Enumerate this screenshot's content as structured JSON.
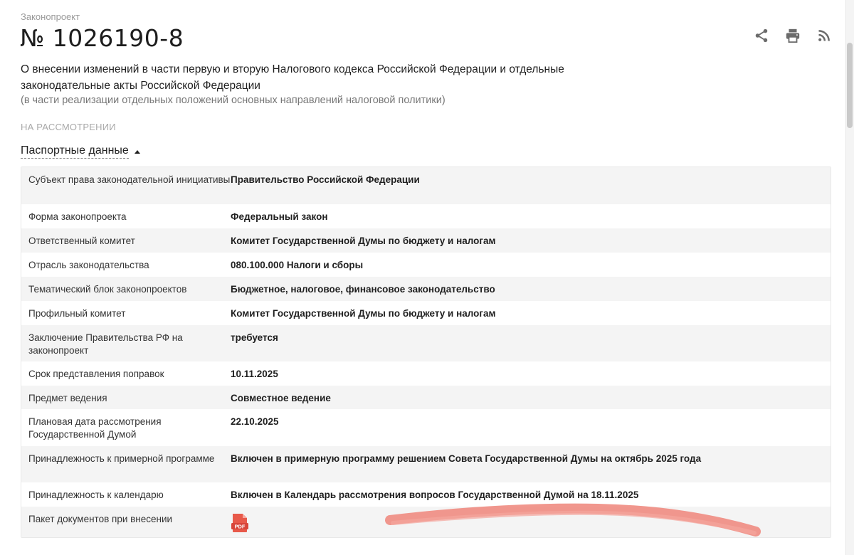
{
  "header": {
    "kicker": "Законопроект",
    "bill_number": "№ 1026190-8",
    "title": "О внесении изменений в части первую и вторую Налогового кодекса Российской Федерации и отдельные законодательные акты Российской Федерации",
    "subtitle": "(в части реализации отдельных положений основных направлений налоговой политики)",
    "status": "НА РАССМОТРЕНИИ",
    "actions": [
      {
        "icon": "share-icon"
      },
      {
        "icon": "print-icon"
      },
      {
        "icon": "rss-icon"
      }
    ]
  },
  "passport": {
    "toggle_label": "Паспортные данные",
    "rows": [
      {
        "key": "Субъект права законодательной инициативы",
        "value": "Правительство Российской Федерации"
      },
      {
        "key": "Форма законопроекта",
        "value": "Федеральный закон"
      },
      {
        "key": "Ответственный комитет",
        "value": "Комитет Государственной Думы по бюджету и налогам"
      },
      {
        "key": "Отрасль законодательства",
        "value": "080.100.000 Налоги и сборы"
      },
      {
        "key": "Тематический блок законопроектов",
        "value": "Бюджетное, налоговое, финансовое законодательство"
      },
      {
        "key": "Профильный комитет",
        "value": "Комитет Государственной Думы по бюджету и налогам"
      },
      {
        "key": "Заключение Правительства РФ на законопроект",
        "value": "требуется"
      },
      {
        "key": "Срок представления поправок",
        "value": "10.11.2025"
      },
      {
        "key": "Предмет ведения",
        "value": "Совместное ведение"
      },
      {
        "key": "Плановая дата рассмотрения Государственной Думой",
        "value": "22.10.2025"
      },
      {
        "key": "Принадлежность к примерной программе",
        "value": "Включен в примерную программу решением Совета Государственной Думы на октябрь 2025 года"
      },
      {
        "key": "Принадлежность к календарю",
        "value": "Включен в Календарь рассмотрения вопросов Государственной Думой на 18.11.2025"
      },
      {
        "key": "Пакет документов при внесении",
        "value": ""
      }
    ],
    "pdf_label": "PDF"
  },
  "colors": {
    "pdf_red": "#e8594a",
    "highlight_stroke": "#f08c82"
  }
}
